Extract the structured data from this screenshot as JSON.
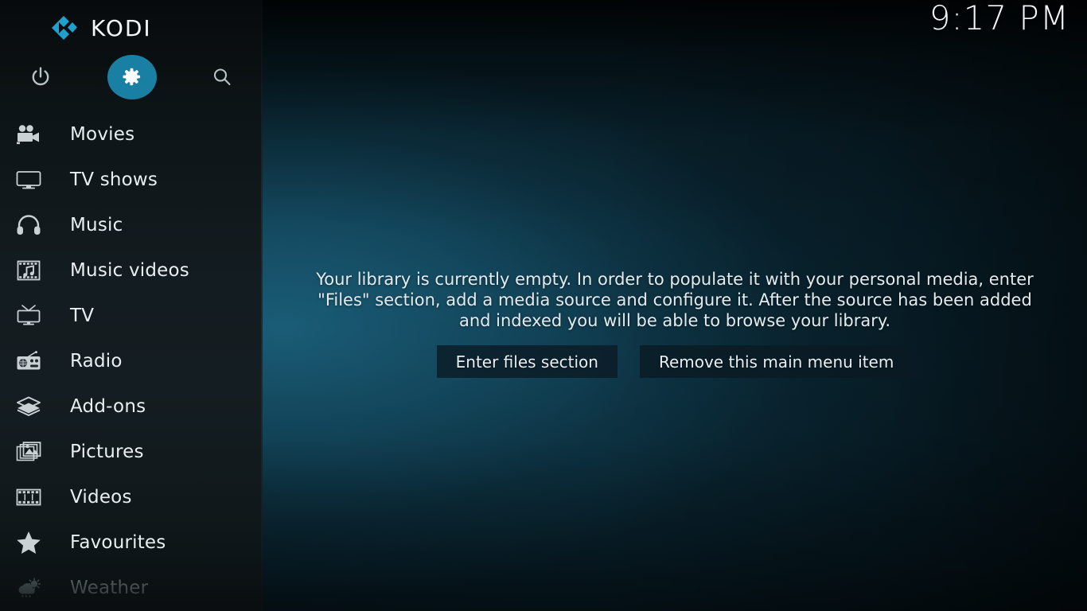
{
  "app": {
    "name": "KODI",
    "logo_icon": "kodi-logo-icon"
  },
  "header": {
    "clock": "9:17 PM"
  },
  "colors": {
    "accent": "#1a80a3",
    "sidebar_bg": "#131c20",
    "content_bg": "#14465a",
    "text": "#e9eef1",
    "text_dim": "#8e989d",
    "button_bg": "#0a1a23"
  },
  "top_actions": [
    {
      "name": "power-button",
      "icon": "power-icon",
      "label": "Power",
      "focused": false
    },
    {
      "name": "settings-button",
      "icon": "gear-icon",
      "label": "Settings",
      "focused": true
    },
    {
      "name": "search-button",
      "icon": "search-icon",
      "label": "Search",
      "focused": false
    }
  ],
  "sidebar": {
    "items": [
      {
        "label": "Movies",
        "icon": "movie-camera-icon",
        "dim": false
      },
      {
        "label": "TV shows",
        "icon": "television-icon",
        "dim": false
      },
      {
        "label": "Music",
        "icon": "headphones-icon",
        "dim": false
      },
      {
        "label": "Music videos",
        "icon": "music-film-icon",
        "dim": false
      },
      {
        "label": "TV",
        "icon": "antenna-tv-icon",
        "dim": false
      },
      {
        "label": "Radio",
        "icon": "radio-icon",
        "dim": false
      },
      {
        "label": "Add-ons",
        "icon": "open-box-icon",
        "dim": false
      },
      {
        "label": "Pictures",
        "icon": "photos-icon",
        "dim": false
      },
      {
        "label": "Videos",
        "icon": "film-strip-icon",
        "dim": false
      },
      {
        "label": "Favourites",
        "icon": "star-icon",
        "dim": false
      },
      {
        "label": "Weather",
        "icon": "weather-cloud-sun-icon",
        "dim": true
      }
    ]
  },
  "main": {
    "empty_message": "Your library is currently empty. In order to populate it with your personal media, enter \"Files\" section, add a media source and configure it. After the source has been added and indexed you will be able to browse your library.",
    "buttons": [
      {
        "label": "Enter files section"
      },
      {
        "label": "Remove this main menu item"
      }
    ]
  }
}
